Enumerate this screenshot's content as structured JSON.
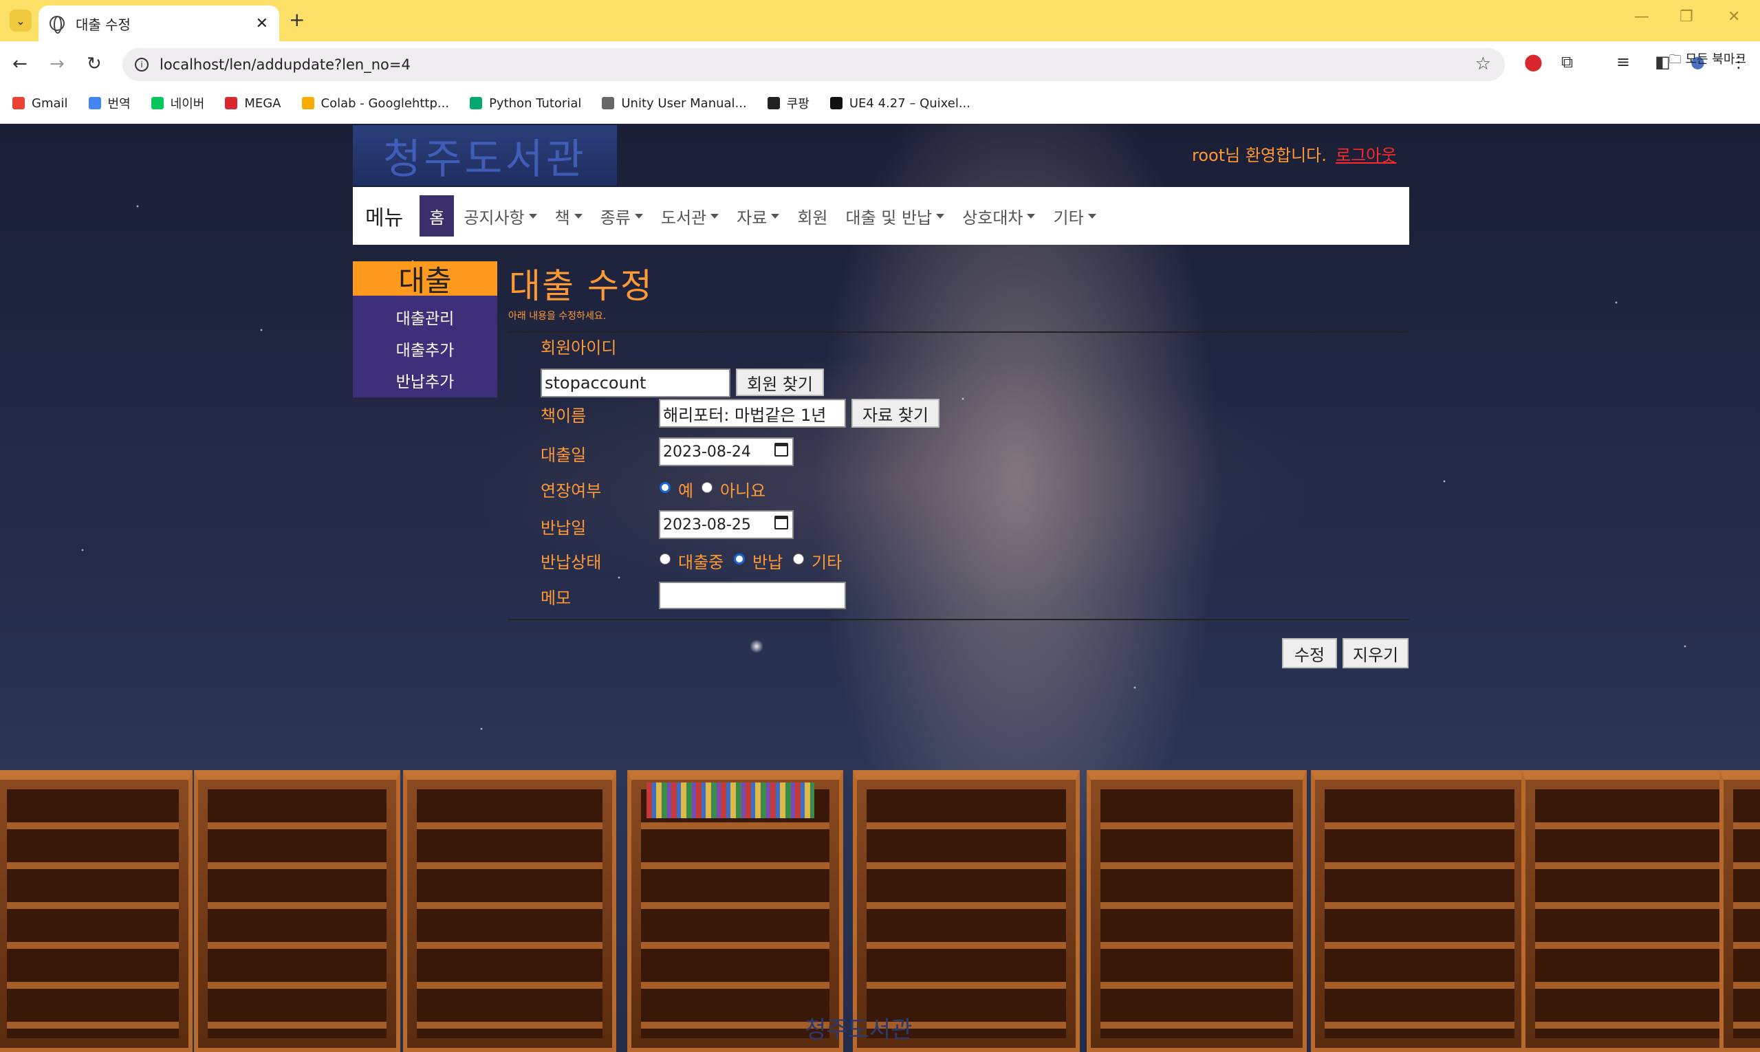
{
  "browser": {
    "tab_title": "대출 수정",
    "url": "localhost/len/addupdate?len_no=4",
    "bookmarks": [
      {
        "label": "Gmail",
        "icon": "gmail-icon",
        "color": "#ea4335"
      },
      {
        "label": "번역",
        "icon": "translate-icon",
        "color": "#4285f4"
      },
      {
        "label": "네이버",
        "icon": "naver-icon",
        "color": "#03c75a"
      },
      {
        "label": "MEGA",
        "icon": "mega-icon",
        "color": "#d9272e"
      },
      {
        "label": "Colab - Googlehttp...",
        "icon": "colab-icon",
        "color": "#f9ab00"
      },
      {
        "label": "Python Tutorial",
        "icon": "w3schools-icon",
        "color": "#04aa6d"
      },
      {
        "label": "Unity User Manual...",
        "icon": "unity-icon",
        "color": "#666666"
      },
      {
        "label": "쿠팡",
        "icon": "globe-icon",
        "color": "#222222"
      },
      {
        "label": "UE4 4.27 – Quixel...",
        "icon": "quixel-icon",
        "color": "#111111"
      }
    ],
    "all_bookmarks": "모든 북마크"
  },
  "site": {
    "logo_text": "청주도서관",
    "welcome": "root님 환영합니다.",
    "logout": "로그아웃",
    "menu_brand": "메뉴",
    "menu": [
      {
        "label": "홈",
        "dropdown": false,
        "active": true
      },
      {
        "label": "공지사항",
        "dropdown": true
      },
      {
        "label": "책",
        "dropdown": true
      },
      {
        "label": "종류",
        "dropdown": true
      },
      {
        "label": "도서관",
        "dropdown": true
      },
      {
        "label": "자료",
        "dropdown": true
      },
      {
        "label": "회원",
        "dropdown": false
      },
      {
        "label": "대출 및 반납",
        "dropdown": true
      },
      {
        "label": "상호대차",
        "dropdown": true
      },
      {
        "label": "기타",
        "dropdown": true
      }
    ],
    "footer_logo": "청주도서관"
  },
  "sidebar": {
    "heading": "대출",
    "items": [
      "대출관리",
      "대출추가",
      "반납추가"
    ]
  },
  "form": {
    "title": "대출 수정",
    "subtitle": "아래 내용을 수정하세요.",
    "member_id_label": "회원아이디",
    "member_id_value": "stopaccount",
    "find_member_button": "회원 찾기",
    "book_label": "책이름",
    "book_value": "해리포터: 마법같은 1년",
    "find_book_button": "자료 찾기",
    "loan_date_label": "대출일",
    "loan_date_value": "2023-08-24",
    "extension_label": "연장여부",
    "extension_options": [
      "예",
      "아니요"
    ],
    "extension_selected": "예",
    "return_date_label": "반납일",
    "return_date_value": "2023-08-25",
    "return_status_label": "반납상태",
    "return_status_options": [
      "대출중",
      "반납",
      "기타"
    ],
    "return_status_selected": "반납",
    "memo_label": "메모",
    "memo_value": "",
    "submit_button": "수정",
    "clear_button": "지우기"
  },
  "colors": {
    "accent_orange": "#ff9933",
    "sidebar_purple": "#3e2f7a",
    "logout_red": "#ff2a2a",
    "radio_blue": "#1a66d8"
  }
}
